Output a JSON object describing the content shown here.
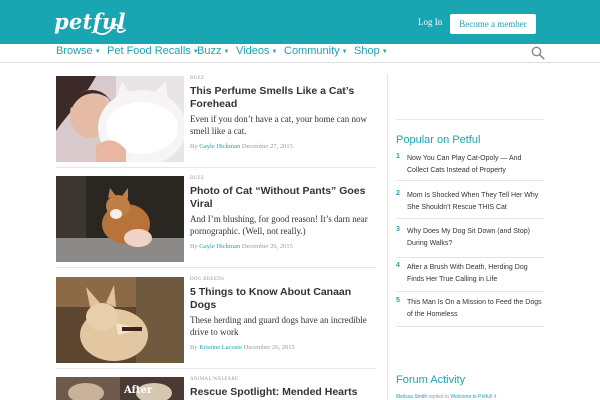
{
  "header": {
    "logo": "petful",
    "login": "Log In",
    "member_button": "Become a member",
    "brand_color": "#1aa5b3"
  },
  "nav": {
    "items": [
      {
        "label": "Browse"
      },
      {
        "label": "Pet Food Recalls"
      },
      {
        "label": "Buzz"
      },
      {
        "label": "Videos"
      },
      {
        "label": "Community"
      },
      {
        "label": "Shop"
      }
    ],
    "search_icon": "search-icon"
  },
  "articles": [
    {
      "category": "Buzz",
      "title": "This Perfume Smells Like a Cat’s Forehead",
      "description": "Even if you don’t have a cat, your home can now smell like a cat.",
      "by": "By",
      "author": "Gayle Hickman",
      "date": "December 27, 2015"
    },
    {
      "category": "Buzz",
      "title": "Photo of Cat “Without Pants” Goes Viral",
      "description": "And I’m blushing, for good reason! It’s darn near pornographic. (Well, not really.)",
      "by": "By",
      "author": "Gayle Hickman",
      "date": "December 26, 2015"
    },
    {
      "category": "Dog Breeds",
      "title": "5 Things to Know About Canaan Dogs",
      "description": "These herding and guard dogs have an incredible drive to work",
      "by": "By",
      "author": "Kristine Lacoste",
      "date": "December 26, 2015"
    },
    {
      "category": "Animal Welfare",
      "title": "Rescue Spotlight: Mended Hearts",
      "thumb_overlay": "After"
    }
  ],
  "sidebar": {
    "popular_heading": "Popular on Petful",
    "popular": [
      {
        "num": "1",
        "text": "Now You Can Play Cat-Opoly — And Collect Cats Instead of Property"
      },
      {
        "num": "2",
        "text": "Mom Is Shocked When They Tell Her Why She Shouldn’t Rescue THIS Cat"
      },
      {
        "num": "3",
        "text": "Why Does My Dog Sit Down (and Stop) During Walks?"
      },
      {
        "num": "4",
        "text": "After a Brush With Death, Herding Dog Finds Her True Calling in Life"
      },
      {
        "num": "5",
        "text": "This Man Is On a Mission to Feed the Dogs of the Homeless"
      }
    ],
    "forum_heading": "Forum Activity",
    "forum_user": "Melissa Smith",
    "forum_action": "replied to",
    "forum_topic": "Welcome to Petful!",
    "forum_count": "4"
  }
}
